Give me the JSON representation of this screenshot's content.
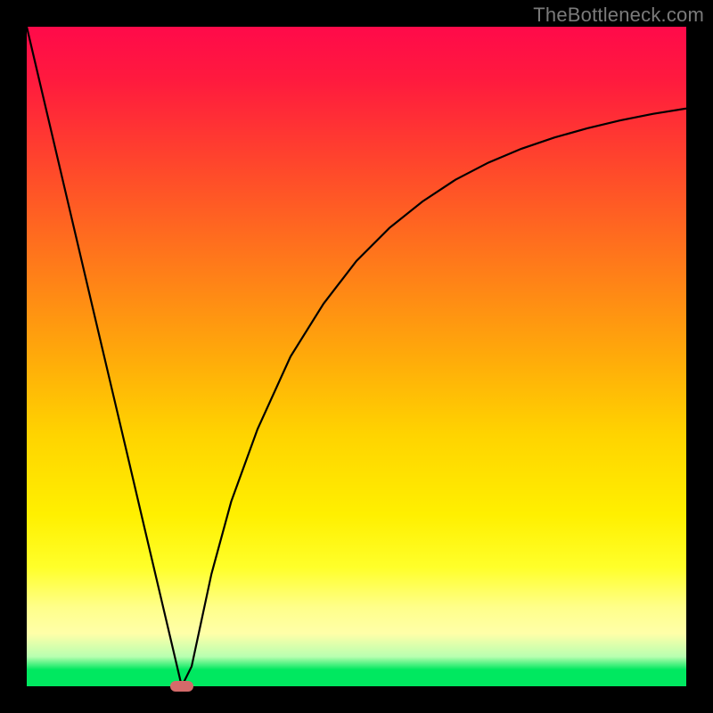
{
  "watermark": "TheBottleneck.com",
  "chart_data": {
    "type": "line",
    "title": "",
    "xlabel": "",
    "ylabel": "",
    "xlim": [
      0,
      100
    ],
    "ylim": [
      0,
      100
    ],
    "grid": false,
    "legend": false,
    "series": [
      {
        "name": "curve",
        "x": [
          0,
          5,
          10,
          15,
          18,
          20,
          22,
          23.5,
          25,
          26.5,
          28,
          31,
          35,
          40,
          45,
          50,
          55,
          60,
          65,
          70,
          75,
          80,
          85,
          90,
          95,
          100
        ],
        "y": [
          100,
          78.7,
          57.4,
          36.2,
          23.4,
          14.9,
          6.4,
          0,
          3,
          10,
          17,
          28,
          39,
          50,
          58,
          64.5,
          69.5,
          73.5,
          76.8,
          79.4,
          81.5,
          83.2,
          84.6,
          85.8,
          86.8,
          87.6
        ]
      }
    ],
    "marker": {
      "x": 23.5,
      "y": 0
    },
    "background_gradient": {
      "stops": [
        {
          "pos": 0.0,
          "color": "#ff0a4a"
        },
        {
          "pos": 0.08,
          "color": "#ff1a3e"
        },
        {
          "pos": 0.22,
          "color": "#ff4a2a"
        },
        {
          "pos": 0.36,
          "color": "#ff7a1a"
        },
        {
          "pos": 0.5,
          "color": "#ffaa0a"
        },
        {
          "pos": 0.62,
          "color": "#ffd400"
        },
        {
          "pos": 0.74,
          "color": "#fff000"
        },
        {
          "pos": 0.82,
          "color": "#ffff2a"
        },
        {
          "pos": 0.88,
          "color": "#ffff8a"
        },
        {
          "pos": 0.92,
          "color": "#ffffa8"
        },
        {
          "pos": 0.955,
          "color": "#b8ffb0"
        },
        {
          "pos": 0.975,
          "color": "#00e860"
        },
        {
          "pos": 1.0,
          "color": "#00e860"
        }
      ]
    }
  }
}
